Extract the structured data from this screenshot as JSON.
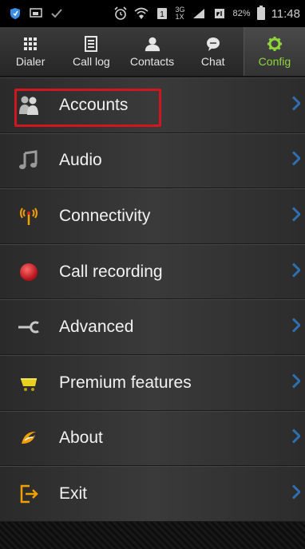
{
  "status_bar": {
    "network_type": "3G",
    "network_type2": "1X",
    "battery_percent": "82%",
    "time": "11:48"
  },
  "tabs": [
    {
      "label": "Dialer",
      "icon": "dialpad-icon",
      "active": false
    },
    {
      "label": "Call log",
      "icon": "call-log-icon",
      "active": false
    },
    {
      "label": "Contacts",
      "icon": "contacts-icon",
      "active": false
    },
    {
      "label": "Chat",
      "icon": "chat-icon",
      "active": false
    },
    {
      "label": "Config",
      "icon": "gear-icon",
      "active": true
    }
  ],
  "menu": {
    "items": [
      {
        "label": "Accounts",
        "icon": "accounts-icon",
        "highlighted": true
      },
      {
        "label": "Audio",
        "icon": "music-note-icon"
      },
      {
        "label": "Connectivity",
        "icon": "antenna-icon"
      },
      {
        "label": "Call recording",
        "icon": "record-dot-icon"
      },
      {
        "label": "Advanced",
        "icon": "wrench-icon"
      },
      {
        "label": "Premium features",
        "icon": "cart-icon"
      },
      {
        "label": "About",
        "icon": "about-swirl-icon"
      },
      {
        "label": "Exit",
        "icon": "exit-icon"
      }
    ]
  },
  "colors": {
    "accent_active": "#8ed63c",
    "highlight_border": "#d0161f",
    "chevron": "#2f6fb0",
    "record_dot": "#d8232a",
    "orange": "#f2a000",
    "cart_yellow": "#e8d020"
  }
}
